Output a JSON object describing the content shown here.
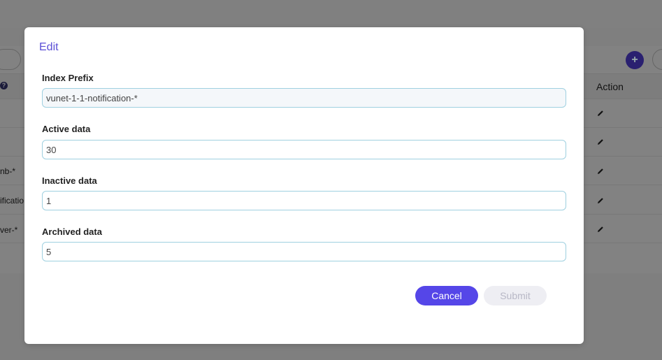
{
  "background": {
    "table": {
      "action_header": "Action",
      "rows": [
        {
          "fragment": ""
        },
        {
          "fragment": ""
        },
        {
          "fragment": "nb-*"
        },
        {
          "fragment": "ificatio"
        },
        {
          "fragment": "ver-*"
        }
      ]
    },
    "add_icon_glyph": "+",
    "help_icon_glyph": "?"
  },
  "modal": {
    "title": "Edit",
    "fields": [
      {
        "label": "Index Prefix",
        "value": "vunet-1-1-notification-*"
      },
      {
        "label": "Active data",
        "value": "30"
      },
      {
        "label": "Inactive data",
        "value": "1"
      },
      {
        "label": "Archived data",
        "value": "5"
      }
    ],
    "buttons": {
      "cancel": "Cancel",
      "submit": "Submit"
    }
  },
  "colors": {
    "accent": "#5546e8",
    "title": "#5b4fd6",
    "input_border": "#9fd0e0",
    "submit_disabled_bg": "#eeeef3",
    "overlay": "#7f7f7f"
  }
}
